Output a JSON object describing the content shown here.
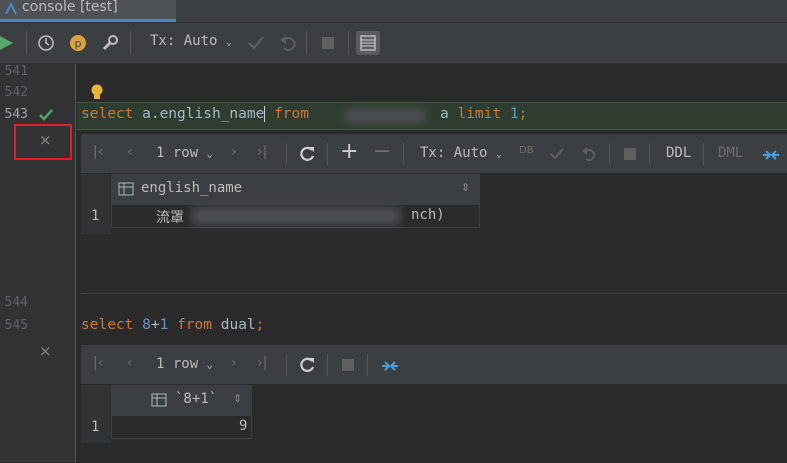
{
  "tab": {
    "title": "console [test]"
  },
  "toolbar": {
    "tx_label": "Tx: Auto",
    "icons": [
      "run-icon",
      "history-icon",
      "profile-p-icon",
      "wrench-icon",
      "commit-check-icon",
      "rollback-icon",
      "stop-icon",
      "output-table-icon"
    ]
  },
  "editor": {
    "lines": [
      {
        "number": "541"
      },
      {
        "number": "542"
      },
      {
        "number": "543"
      },
      {
        "number": "544"
      },
      {
        "number": "545"
      }
    ],
    "query1": {
      "select": "select",
      "col": " a.english_name",
      "from": "from",
      "alias": "a",
      "limit": "limit",
      "num": "1",
      "semi": ";"
    },
    "query2": {
      "select": "select",
      "expr_num1": "8",
      "plus": "+",
      "expr_num2": "1",
      "from": "from",
      "table": "dual",
      "semi": ";"
    }
  },
  "result1": {
    "rows_label": "1 row",
    "tx_label": "Tx: Auto",
    "ddl_label": "DDL",
    "dml_label": "DML",
    "column": "english_name",
    "row_index": "1",
    "cell_prefix": "流罩",
    "cell_suffix": "nch)"
  },
  "result2": {
    "rows_label": "1 row",
    "column": "`8+1`",
    "row_index": "1",
    "value": "9"
  },
  "colors": {
    "background": "#2b2b2b",
    "toolbar": "#3c3f41",
    "keyword": "#cc7832",
    "number": "#6897bb",
    "run_green": "#59a869",
    "highlight_red": "#e02020"
  }
}
